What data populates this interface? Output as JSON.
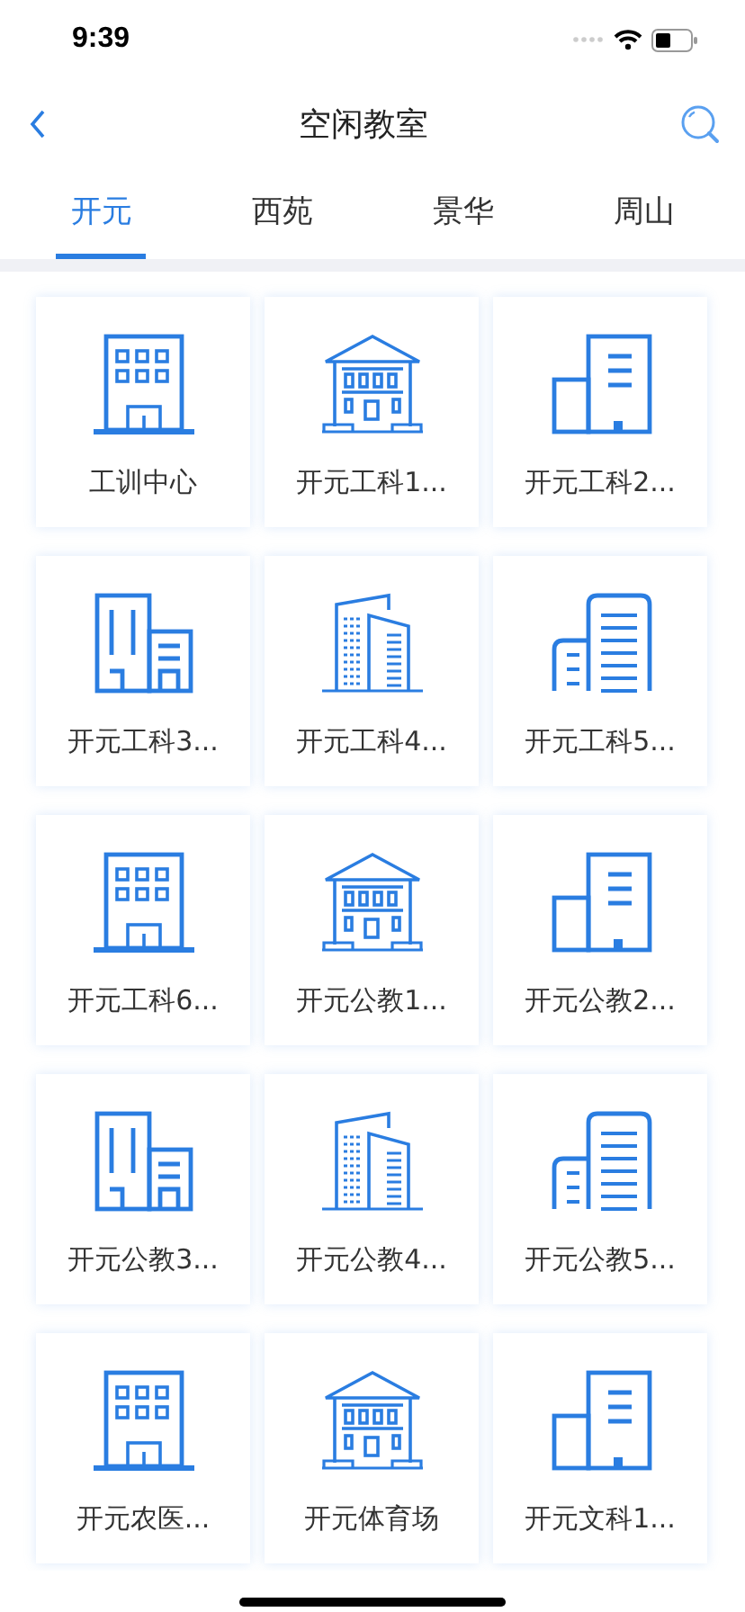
{
  "status_bar": {
    "time": "9:39"
  },
  "nav": {
    "title": "空闲教室"
  },
  "tabs": [
    {
      "label": "开元",
      "selected": true
    },
    {
      "label": "西苑",
      "selected": false
    },
    {
      "label": "景华",
      "selected": false
    },
    {
      "label": "周山",
      "selected": false
    }
  ],
  "buildings": [
    {
      "name": "工训中心",
      "kind": "office"
    },
    {
      "name": "开元工科1...",
      "kind": "classical"
    },
    {
      "name": "开元工科2...",
      "kind": "blocks"
    },
    {
      "name": "开元工科3...",
      "kind": "split"
    },
    {
      "name": "开元工科4...",
      "kind": "tower"
    },
    {
      "name": "开元工科5...",
      "kind": "rounded"
    },
    {
      "name": "开元工科6...",
      "kind": "office"
    },
    {
      "name": "开元公教1...",
      "kind": "classical"
    },
    {
      "name": "开元公教2...",
      "kind": "blocks"
    },
    {
      "name": "开元公教3...",
      "kind": "split"
    },
    {
      "name": "开元公教4...",
      "kind": "tower"
    },
    {
      "name": "开元公教5...",
      "kind": "rounded"
    },
    {
      "name": "开元农医...",
      "kind": "office"
    },
    {
      "name": "开元体育场",
      "kind": "classical"
    },
    {
      "name": "开元文科1...",
      "kind": "blocks"
    }
  ]
}
